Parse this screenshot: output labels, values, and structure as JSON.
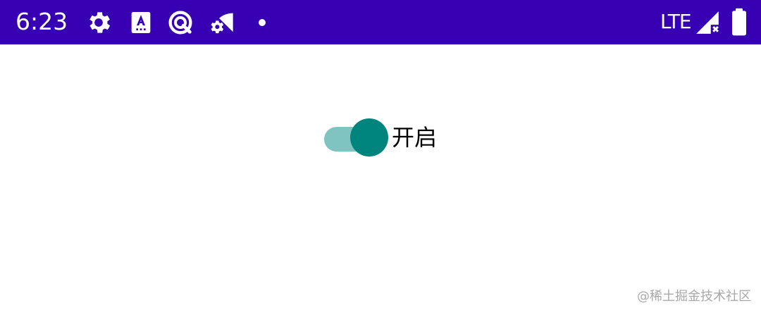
{
  "status_bar": {
    "time": "6:23",
    "network": "LTE",
    "background_color": "#3700b3",
    "icons": [
      "settings-icon",
      "keyboard-a-icon",
      "data-saver-icon",
      "wifi-settings-icon",
      "notification-dot-icon",
      "signal-icon",
      "battery-icon"
    ]
  },
  "switch": {
    "label": "开启",
    "checked": true,
    "track_color": "#80c4c2",
    "thumb_color": "#00857e"
  },
  "watermark": {
    "text": "@稀土掘金技术社区"
  }
}
